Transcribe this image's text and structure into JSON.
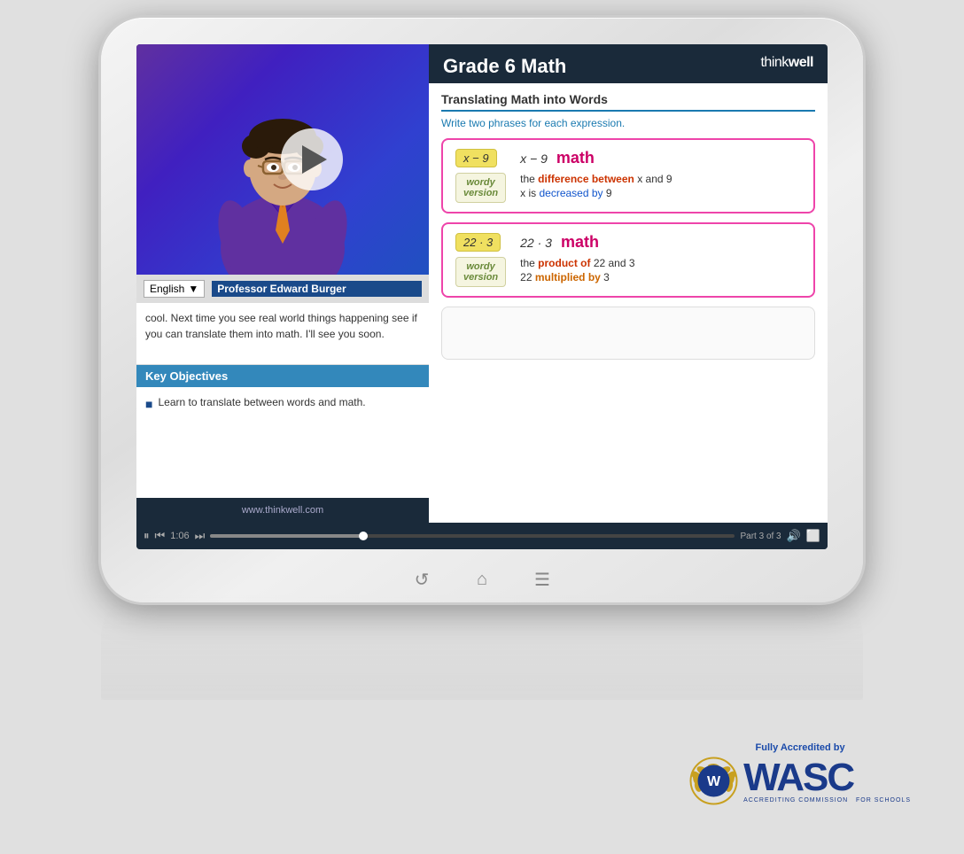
{
  "tablet": {
    "screen": {
      "left_panel": {
        "language_selector": {
          "label": "English",
          "dropdown_symbol": "▼"
        },
        "professor_label": "Professor Edward Burger",
        "transcript": "cool. Next time you see real world things happening see if you can translate them into math. I'll see you soon.",
        "objectives_header": "Key Objectives",
        "objectives": [
          "Learn to translate between words and math."
        ],
        "website": "www.thinkwell.com",
        "controls": {
          "pause_symbol": "⏸",
          "prev_symbol": "⏮",
          "next_symbol": "⏭",
          "time": "1:06",
          "part_label": "Part 3 of 3"
        }
      },
      "right_panel": {
        "header": {
          "course_title": "Grade 6 Math",
          "brand": "thinkwell"
        },
        "lesson": {
          "title": "Translating Math into Words",
          "instruction": "Write two phrases for each expression.",
          "expressions": [
            {
              "tag": "x − 9",
              "equation": "x − 9",
              "math_label": "math",
              "phrase1_prefix": "the ",
              "phrase1_highlight": "difference between",
              "phrase1_suffix": " x and 9",
              "phrase2_prefix": "x is ",
              "phrase2_highlight": "decreased by",
              "phrase2_suffix": " 9"
            },
            {
              "tag": "22 · 3",
              "equation": "22 · 3",
              "math_label": "math",
              "phrase1_prefix": "the ",
              "phrase1_highlight": "product of",
              "phrase1_suffix": " 22 and 3",
              "phrase2_prefix": "22 ",
              "phrase2_highlight": "multiplied by",
              "phrase2_suffix": " 3"
            }
          ]
        }
      }
    },
    "nav_icons": [
      "↺",
      "⌂",
      "☰"
    ]
  },
  "accreditation": {
    "top_text": "Fully Accredited by",
    "letters": "WASC",
    "sub_text": "ACCREDITING COMMISSION   FOR SCHOOLS"
  }
}
